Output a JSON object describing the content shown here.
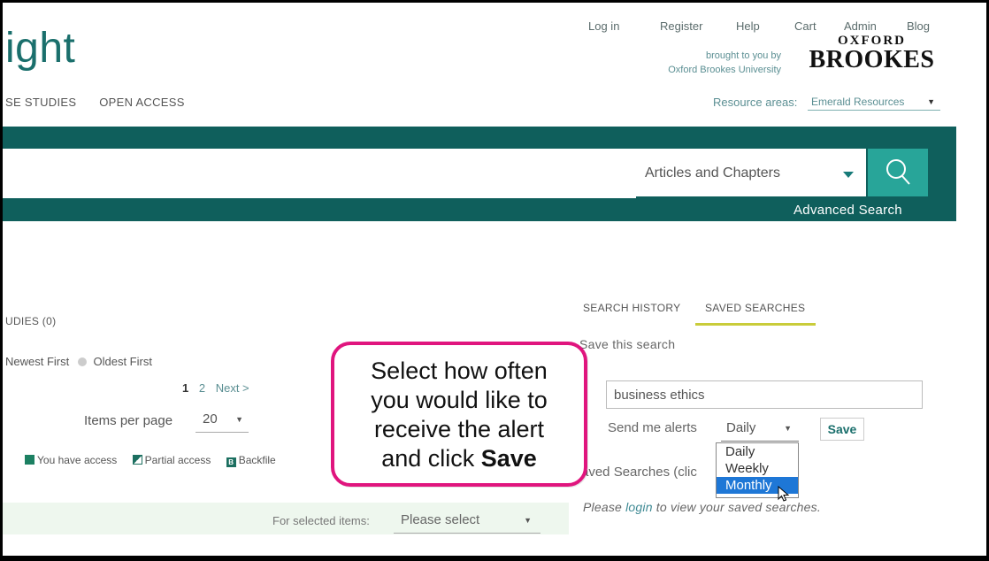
{
  "header": {
    "top_links": [
      "Log in",
      "Register",
      "Help",
      "Cart",
      "Admin",
      "Blog"
    ],
    "logo_text": "ight",
    "brought_line1": "brought to you by",
    "brought_line2": "Oxford Brookes University",
    "oxford_line1": "OXFORD",
    "oxford_line2": "BROOKES"
  },
  "nav": {
    "items": [
      "SE STUDIES",
      "OPEN ACCESS"
    ],
    "resource_label": "Resource areas:",
    "resource_value": "Emerald Resources"
  },
  "search": {
    "query": "",
    "type_value": "Articles and Chapters",
    "advanced_label": "Advanced Search"
  },
  "results": {
    "studies_tab": "UDIES (0)",
    "sort_newest": "Newest First",
    "sort_oldest": "Oldest First",
    "page_current": "1",
    "page_2": "2",
    "page_next": "Next >",
    "items_per_page_label": "Items per page",
    "items_per_page_value": "20",
    "legend_access": "You have access",
    "legend_partial": "Partial access",
    "legend_backfile": "Backfile",
    "for_selected_label": "For selected items:",
    "for_selected_value": "Please select"
  },
  "sidebar": {
    "tab_history": "SEARCH HISTORY",
    "tab_saved": "SAVED SEARCHES",
    "save_this_search": "Save this search",
    "search_name_value": "business ethics",
    "send_alerts_label": "Send me alerts",
    "frequency_value": "Daily",
    "frequency_options": [
      "Daily",
      "Weekly",
      "Monthly"
    ],
    "save_button": "Save",
    "saved_searches_heading": "aved Searches (clic",
    "login_prefix": "Please ",
    "login_link": "login",
    "login_suffix": " to view your saved searches."
  },
  "callout": {
    "line1": "Select how often",
    "line2": "you would like to",
    "line3": "receive the alert",
    "line4_prefix": "and click ",
    "line4_bold": "Save"
  },
  "colors": {
    "brand_teal": "#0f5f5c",
    "search_button": "#28a599",
    "callout_border": "#e0157e",
    "dropdown_highlight": "#1e77d6",
    "tab_underline": "#c9cc3a"
  }
}
